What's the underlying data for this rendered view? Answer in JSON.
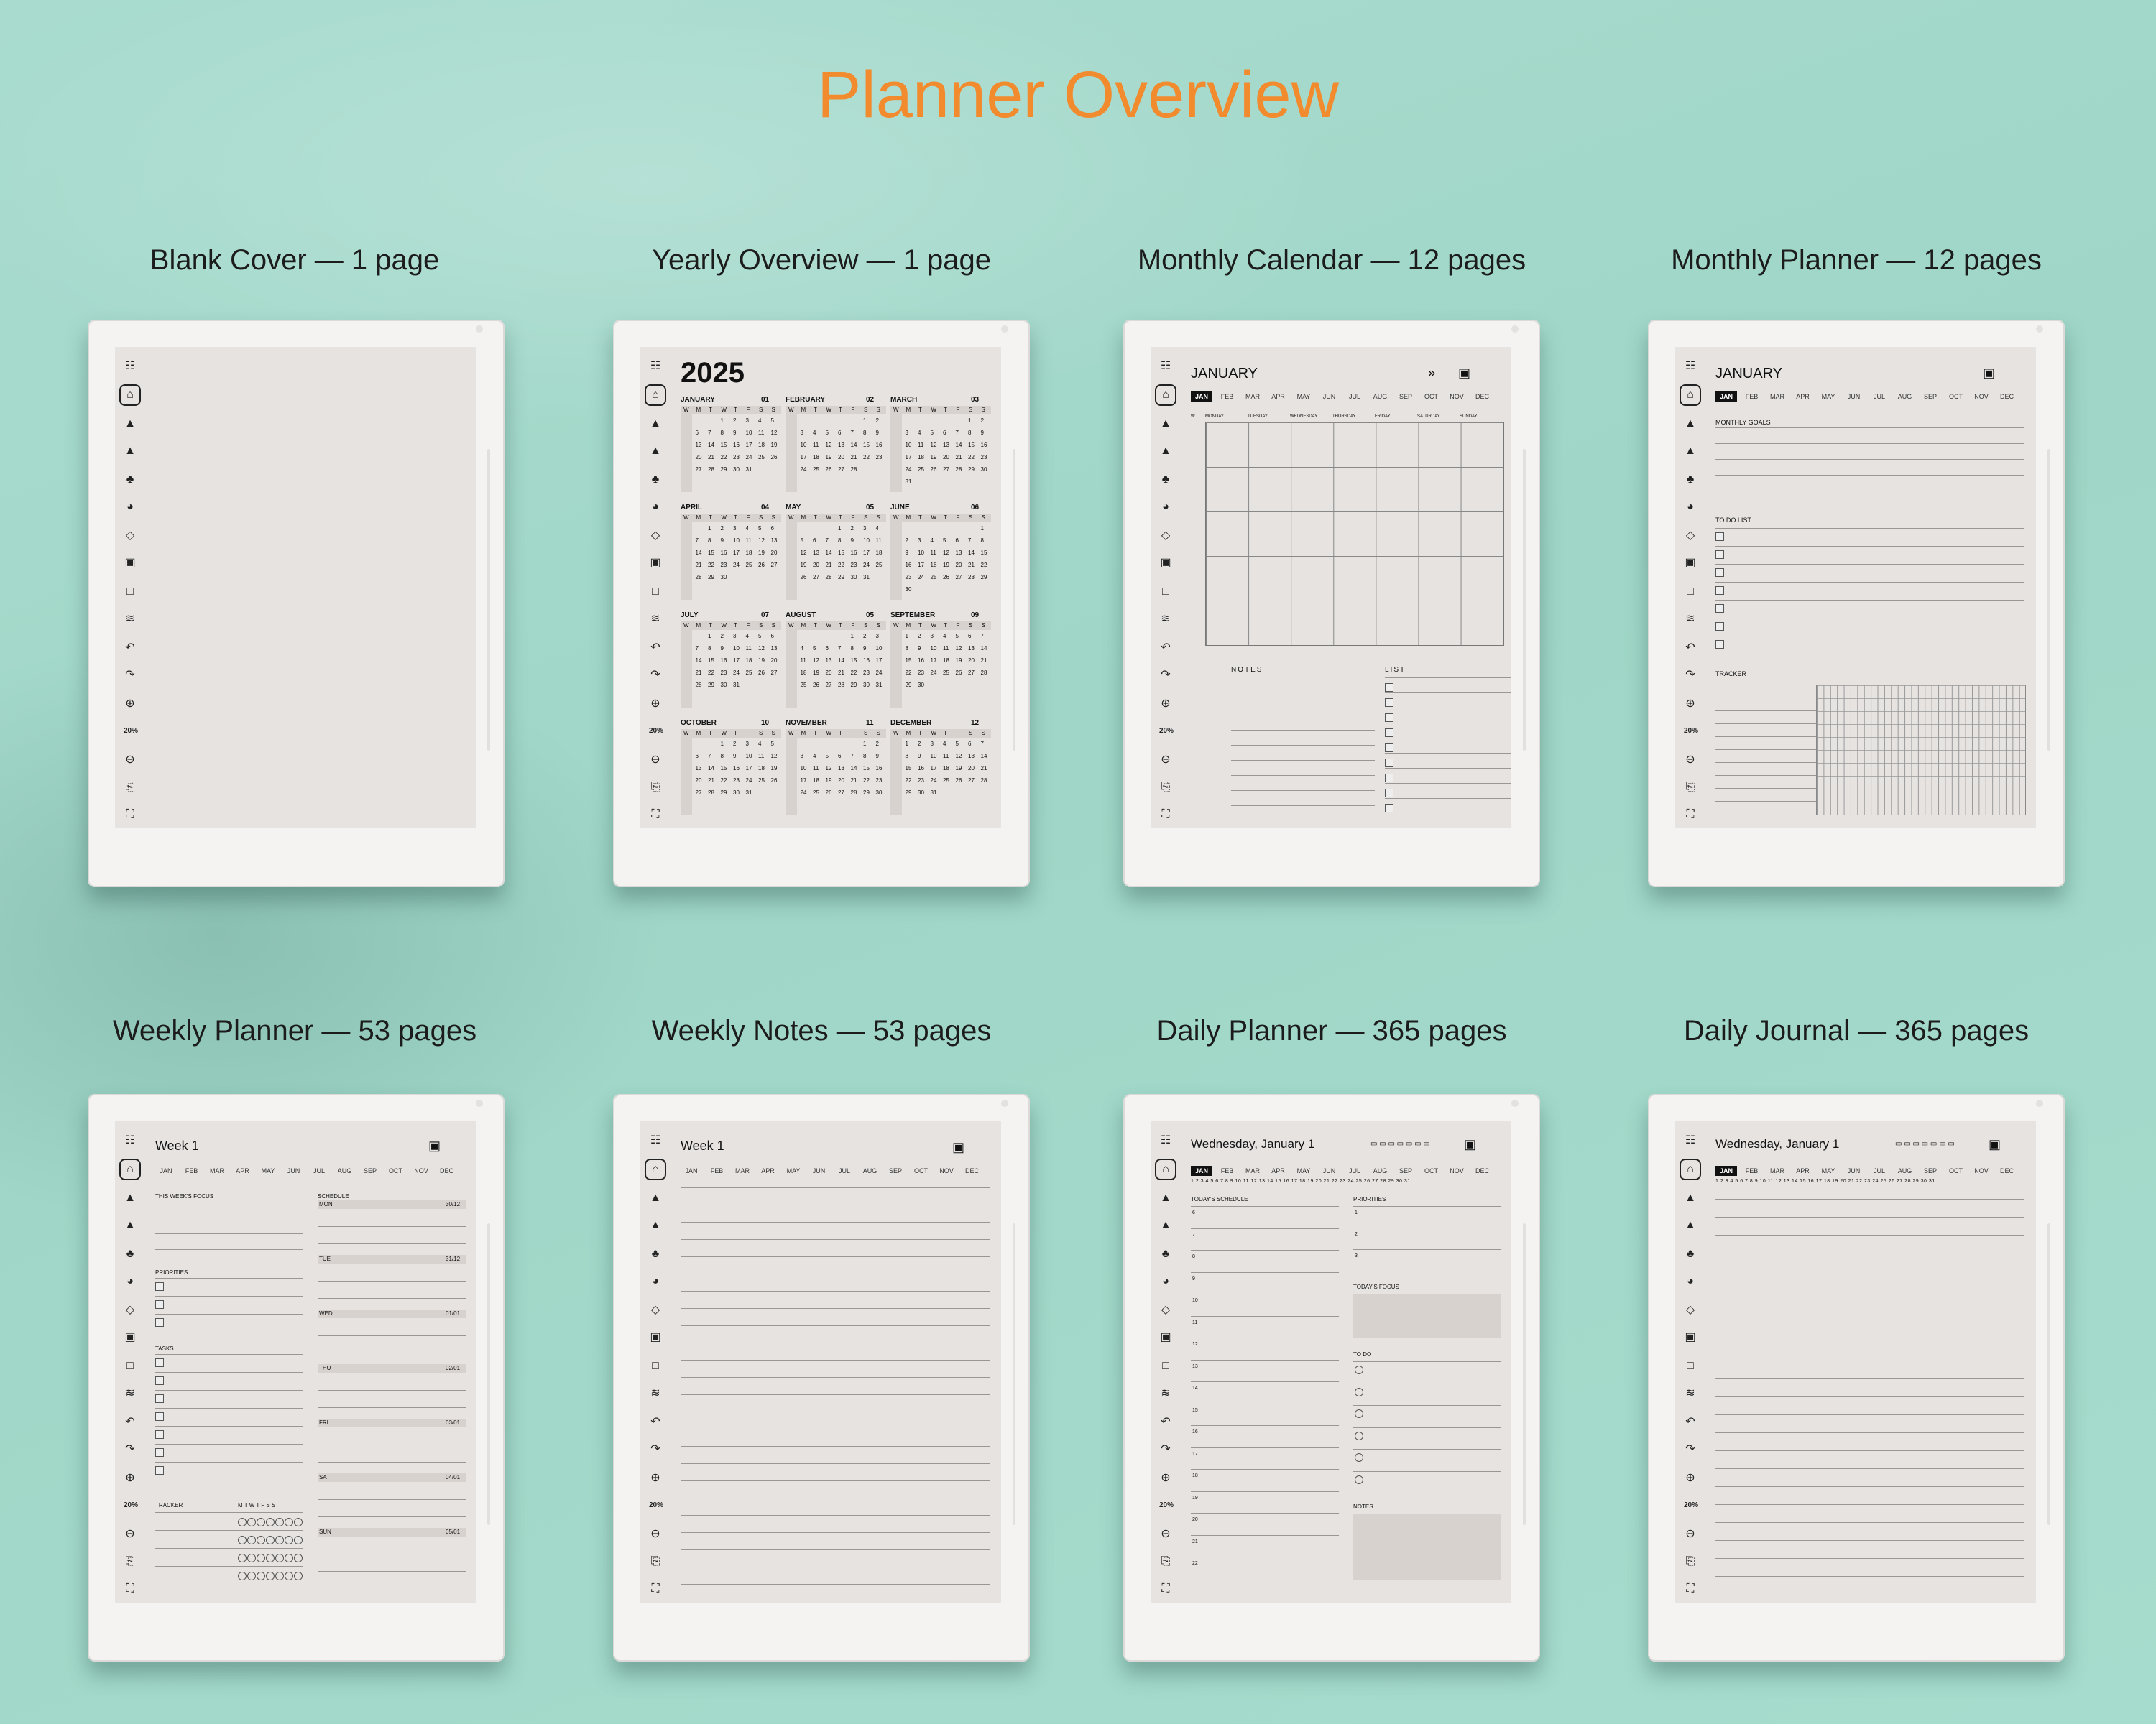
{
  "page": {
    "title": "Planner Overview"
  },
  "colors": {
    "title": "#f28a2e",
    "background": "#a4d9cb",
    "screen": "#e6e3e1",
    "device": "#f4f3f2"
  },
  "toolbar": {
    "icons": [
      "template-list-icon",
      "notebook-icon",
      "pen-icon",
      "highlighter-icon",
      "brush-icon",
      "palette-icon",
      "eraser-icon",
      "selection-icon",
      "shape-icon",
      "layers-icon",
      "undo-icon",
      "redo-icon",
      "zoom-in-icon",
      "zoom-out-icon",
      "export-icon",
      "fullscreen-icon"
    ],
    "zoom": "20%"
  },
  "months_short": [
    "JAN",
    "FEB",
    "MAR",
    "APR",
    "MAY",
    "JUN",
    "JUL",
    "AUG",
    "SEP",
    "OCT",
    "NOV",
    "DEC"
  ],
  "cards": [
    {
      "label": "Blank Cover — 1 page"
    },
    {
      "label": "Yearly Overview — 1 page",
      "year": "2025",
      "months": [
        {
          "name": "JANUARY",
          "num": "01"
        },
        {
          "name": "FEBRUARY",
          "num": "02"
        },
        {
          "name": "MARCH",
          "num": "03"
        },
        {
          "name": "APRIL",
          "num": "04"
        },
        {
          "name": "MAY",
          "num": "05"
        },
        {
          "name": "JUNE",
          "num": "06"
        },
        {
          "name": "JULY",
          "num": "07"
        },
        {
          "name": "AUGUST",
          "num": "05"
        },
        {
          "name": "SEPTEMBER",
          "num": "09"
        },
        {
          "name": "OCTOBER",
          "num": "10"
        },
        {
          "name": "NOVEMBER",
          "num": "11"
        },
        {
          "name": "DECEMBER",
          "num": "12"
        }
      ],
      "weekdays": [
        "W",
        "M",
        "T",
        "W",
        "T",
        "F",
        "S",
        "S"
      ]
    },
    {
      "label": "Monthly Calendar — 12 pages",
      "month": "JANUARY",
      "days": [
        "W",
        "MONDAY",
        "TUESDAY",
        "WEDNESDAY",
        "THURSDAY",
        "FRIDAY",
        "SATURDAY",
        "SUNDAY"
      ],
      "notes": "NOTES",
      "list": "LIST"
    },
    {
      "label": "Monthly Planner — 12 pages",
      "month": "JANUARY",
      "goals": "MONTHLY GOALS",
      "todo": "TO DO LIST",
      "tracker": "TRACKER"
    },
    {
      "label": "Weekly Planner — 53 pages",
      "week": "Week 1",
      "focus": "THIS WEEK'S FOCUS",
      "schedule": "SCHEDULE",
      "priorities": "PRIORITIES",
      "tasks": "TASKS",
      "tracker": "TRACKER",
      "tracker_days": "M T W T F S S",
      "schedule_days": [
        {
          "d": "MON",
          "date": "30/12"
        },
        {
          "d": "TUE",
          "date": "31/12"
        },
        {
          "d": "WED",
          "date": "01/01"
        },
        {
          "d": "THU",
          "date": "02/01"
        },
        {
          "d": "FRI",
          "date": "03/01"
        },
        {
          "d": "SAT",
          "date": "04/01"
        },
        {
          "d": "SUN",
          "date": "05/01"
        }
      ]
    },
    {
      "label": "Weekly Notes — 53 pages",
      "week": "Week 1"
    },
    {
      "label": "Daily Planner — 365 pages",
      "date": "Wednesday, January 1",
      "schedule": "TODAY'S SCHEDULE",
      "priorities": "PRIORITIES",
      "focus": "TODAY'S FOCUS",
      "todo": "TO DO",
      "notes": "NOTES",
      "hours": [
        "6",
        "7",
        "8",
        "9",
        "10",
        "11",
        "12",
        "13",
        "14",
        "15",
        "16",
        "17",
        "18",
        "19",
        "20",
        "21",
        "22"
      ]
    },
    {
      "label": "Daily Journal — 365 pages",
      "date": "Wednesday, January 1"
    }
  ]
}
